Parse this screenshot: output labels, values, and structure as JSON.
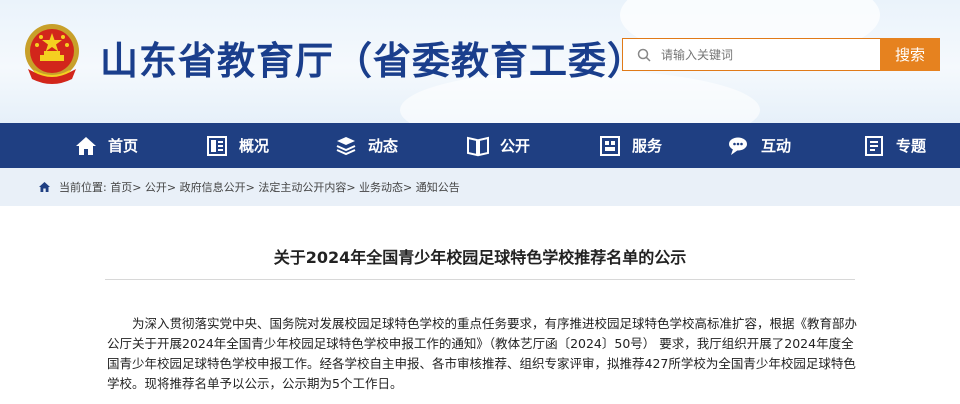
{
  "header": {
    "site_title": "山东省教育厅（省委教育工委）",
    "search_placeholder": "请输入关键词",
    "search_button": "搜索"
  },
  "nav": {
    "items": [
      {
        "label": "首页",
        "icon": "home-icon"
      },
      {
        "label": "概况",
        "icon": "overview-icon"
      },
      {
        "label": "动态",
        "icon": "news-icon"
      },
      {
        "label": "公开",
        "icon": "book-icon"
      },
      {
        "label": "服务",
        "icon": "service-icon"
      },
      {
        "label": "互动",
        "icon": "chat-icon"
      },
      {
        "label": "专题",
        "icon": "topic-icon"
      }
    ]
  },
  "breadcrumb": {
    "text": "当前位置: 首页> 公开> 政府信息公开> 法定主动公开内容> 业务动态> 通知公告"
  },
  "article": {
    "title": "关于2024年全国青少年校园足球特色学校推荐名单的公示",
    "paragraph": "为深入贯彻落实党中央、国务院对发展校园足球特色学校的重点任务要求，有序推进校园足球特色学校高标准扩容，根据《教育部办公厅关于开展2024年全国青少年校园足球特色学校申报工作的通知》（教体艺厅函〔2024〕50号） 要求，我厅组织开展了2024年度全国青少年校园足球特色学校申报工作。经各学校自主申报、各市审核推荐、组织专家评审，拟推荐427所学校为全国青少年校园足球特色学校。现将推荐名单予以公示，公示期为5个工作日。"
  },
  "colors": {
    "brand_blue": "#1f3f82",
    "title_blue": "#1a3e8c",
    "accent_orange": "#e6821f",
    "breadcrumb_bg": "#e9f0f8"
  }
}
